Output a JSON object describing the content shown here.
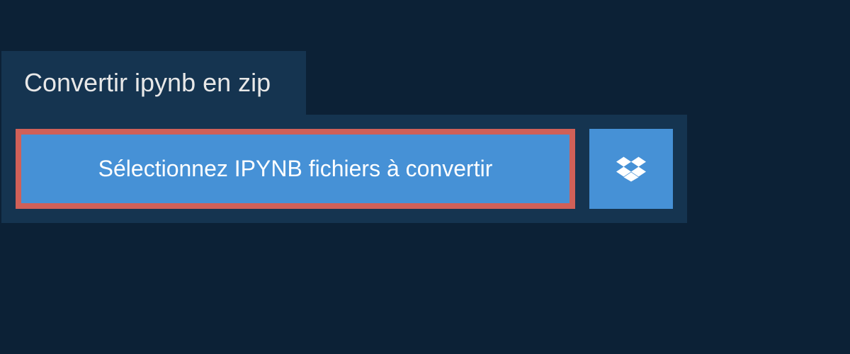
{
  "tab": {
    "title": "Convertir ipynb en zip"
  },
  "panel": {
    "select_button_label": "Sélectionnez IPYNB fichiers à convertir"
  }
}
